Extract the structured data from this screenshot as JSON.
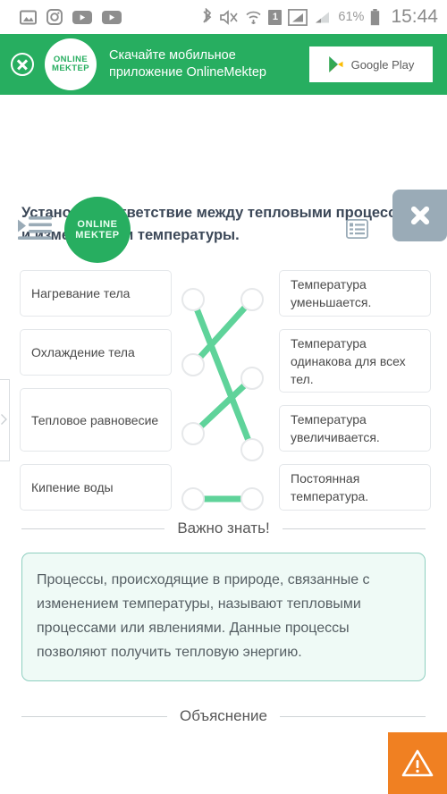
{
  "statusbar": {
    "icons_left": [
      "gallery-icon",
      "instagram-icon",
      "youtube-icon",
      "youtube-music-icon"
    ],
    "icons_right": [
      "bluetooth-icon",
      "mute-icon",
      "wifi-icon",
      "sim-1-icon",
      "signal-strong-icon",
      "signal-weak-icon"
    ],
    "sim_label": "1",
    "battery_text": "61%",
    "clock": "15:44"
  },
  "promo": {
    "close_label": "close-promo",
    "logo_line1": "ONLINE",
    "logo_line2": "MEKTEP",
    "text_line1": "Скачайте мобильное",
    "text_line2": "приложение OnlineMektep",
    "store_button": "Google Play"
  },
  "header": {
    "menu_icon": "indent-list-icon",
    "logo_line1": "ONLINE",
    "logo_line2": "MEKTEP",
    "list_icon": "list-view-icon",
    "crown_icon": "crown-icon",
    "close_overlay": "close-ad-overlay"
  },
  "question": {
    "text": "Установи соответствие между тепловыми процессами и изменениями температуры."
  },
  "matching": {
    "left": [
      "Нагревание тела",
      "Охлаждение тела",
      "Тепловое равновесие",
      "Кипение воды"
    ],
    "right": [
      "Температура уменьшается.",
      "Температура одинакова для всех тел.",
      "Температура увеличивается.",
      "Постоянная температура."
    ],
    "connections": [
      {
        "from": 0,
        "to": 2
      },
      {
        "from": 1,
        "to": 0
      },
      {
        "from": 2,
        "to": 1
      },
      {
        "from": 3,
        "to": 3
      }
    ],
    "line_color": "#5fd39a",
    "node_color": "#e6e8ea"
  },
  "sections": {
    "important_title": "Важно знать!",
    "important_body": "Процессы, происходящие в природе, связанные с изменением температуры, называют тепловыми процессами или явлениями. Данные процессы позволяют получить тепловую энергию.",
    "explanation_title": "Объяснение"
  },
  "report": {
    "icon": "warning-triangle-icon",
    "color": "#f08022"
  },
  "theme": {
    "brand_green": "#27ae60",
    "accent_green": "#5fd39a",
    "info_bg": "#effaf6",
    "info_border": "#8fcfc0",
    "grey_icon": "#9aabb7"
  }
}
